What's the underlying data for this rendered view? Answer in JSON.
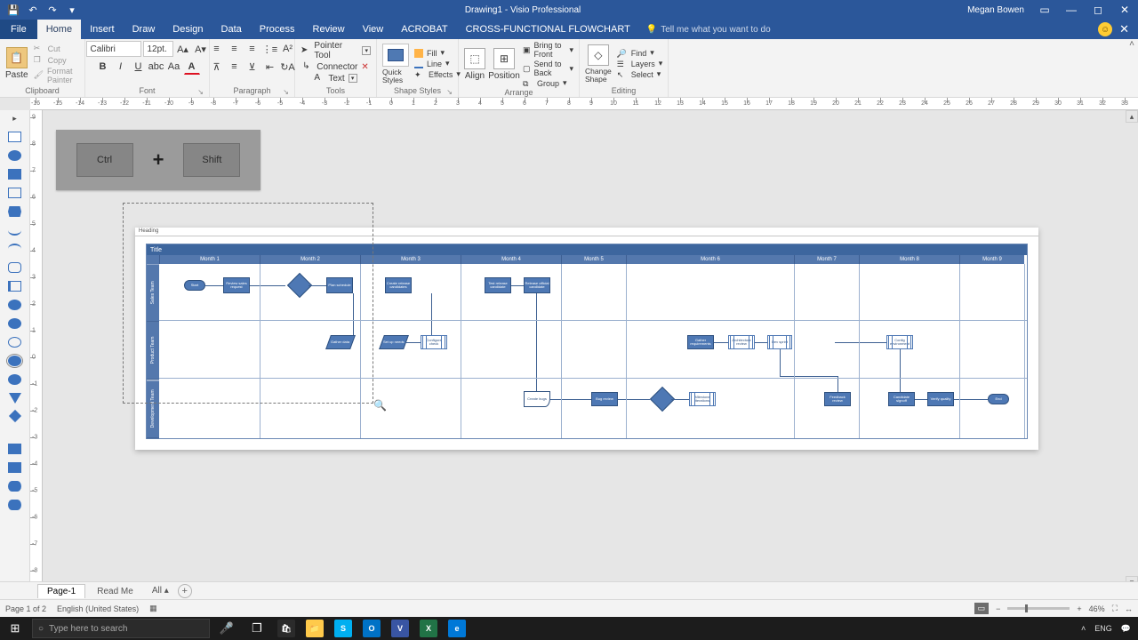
{
  "titlebar": {
    "title": "Drawing1 - Visio Professional",
    "user": "Megan Bowen"
  },
  "ribbonTabs": {
    "file": "File",
    "tabs": [
      "Home",
      "Insert",
      "Draw",
      "Design",
      "Data",
      "Process",
      "Review",
      "View",
      "ACROBAT",
      "CROSS-FUNCTIONAL FLOWCHART"
    ],
    "tellme": "Tell me what you want to do"
  },
  "ribbon": {
    "clipboard": {
      "paste": "Paste",
      "cut": "Cut",
      "copy": "Copy",
      "formatPainter": "Format Painter",
      "label": "Clipboard"
    },
    "font": {
      "name": "Calibri",
      "size": "12pt.",
      "label": "Font"
    },
    "paragraph": {
      "label": "Paragraph"
    },
    "tools": {
      "pointer": "Pointer Tool",
      "connector": "Connector",
      "text": "Text",
      "label": "Tools"
    },
    "shapeStyles": {
      "quick": "Quick Styles",
      "fill": "Fill",
      "line": "Line",
      "effects": "Effects",
      "label": "Shape Styles"
    },
    "arrange": {
      "align": "Align",
      "position": "Position",
      "bringFront": "Bring to Front",
      "sendBack": "Send to Back",
      "group": "Group",
      "label": "Arrange"
    },
    "editing": {
      "change": "Change Shape",
      "find": "Find",
      "layers": "Layers",
      "select": "Select",
      "label": "Editing"
    }
  },
  "keyOverlay": {
    "k1": "Ctrl",
    "plus": "+",
    "k2": "Shift"
  },
  "ruler": {
    "h": [
      "-16",
      "-15",
      "-14",
      "-13",
      "-12",
      "-11",
      "-10",
      "-9",
      "-8",
      "-7",
      "-6",
      "-5",
      "-4",
      "-3",
      "-2",
      "-1",
      "0",
      "1",
      "2",
      "3",
      "4",
      "5",
      "6",
      "7",
      "8",
      "9",
      "10",
      "11",
      "12",
      "13",
      "14",
      "15",
      "16",
      "17",
      "18",
      "19",
      "20",
      "21",
      "22",
      "23",
      "24",
      "25",
      "26",
      "27",
      "28",
      "29",
      "30",
      "31",
      "32",
      "33"
    ],
    "v": [
      "9",
      "8",
      "7",
      "6",
      "5",
      "4",
      "3",
      "2",
      "1",
      "0",
      "-1",
      "-2",
      "-3",
      "-4",
      "-5",
      "-6",
      "-7",
      "-8"
    ]
  },
  "page": {
    "heading": "Heading",
    "title": "Title",
    "columns": [
      "Month 1",
      "Month 2",
      "Month 3",
      "Month 4",
      "Month 5",
      "Month 6",
      "Month 7",
      "Month 8",
      "Month 9"
    ],
    "lanes": [
      "Sales Team",
      "Product Team",
      "Development Team"
    ]
  },
  "shapes": {
    "start": "Start",
    "reviewReq": "Review sales request",
    "dec1": "",
    "plan": "Plan schedule",
    "candidates": "Create release candidates",
    "candTest": "Test release candidate",
    "releaseTest": "Release official candidate",
    "gatherData": "Gather data",
    "needs": "Set up needs",
    "configCheck": "Configure check",
    "gatherReq": "Gather requirements",
    "archReview": "Architecture review",
    "devSprint": "Dev sprint",
    "configEnv": "Config environment",
    "createBugs": "Create bugs",
    "bugReview": "Bug review",
    "milestone": "Milestone iterations",
    "feedback": "Feedback review",
    "candSignoff": "Candidate signoff",
    "verify": "Verify quality",
    "end": "End"
  },
  "pagetabs": {
    "p1": "Page-1",
    "p2": "Read Me",
    "all": "All"
  },
  "status": {
    "page": "Page 1 of 2",
    "lang": "English (United States)",
    "zoom": "46%"
  },
  "taskbar": {
    "search": "Type here to search",
    "lang": "ENG"
  }
}
